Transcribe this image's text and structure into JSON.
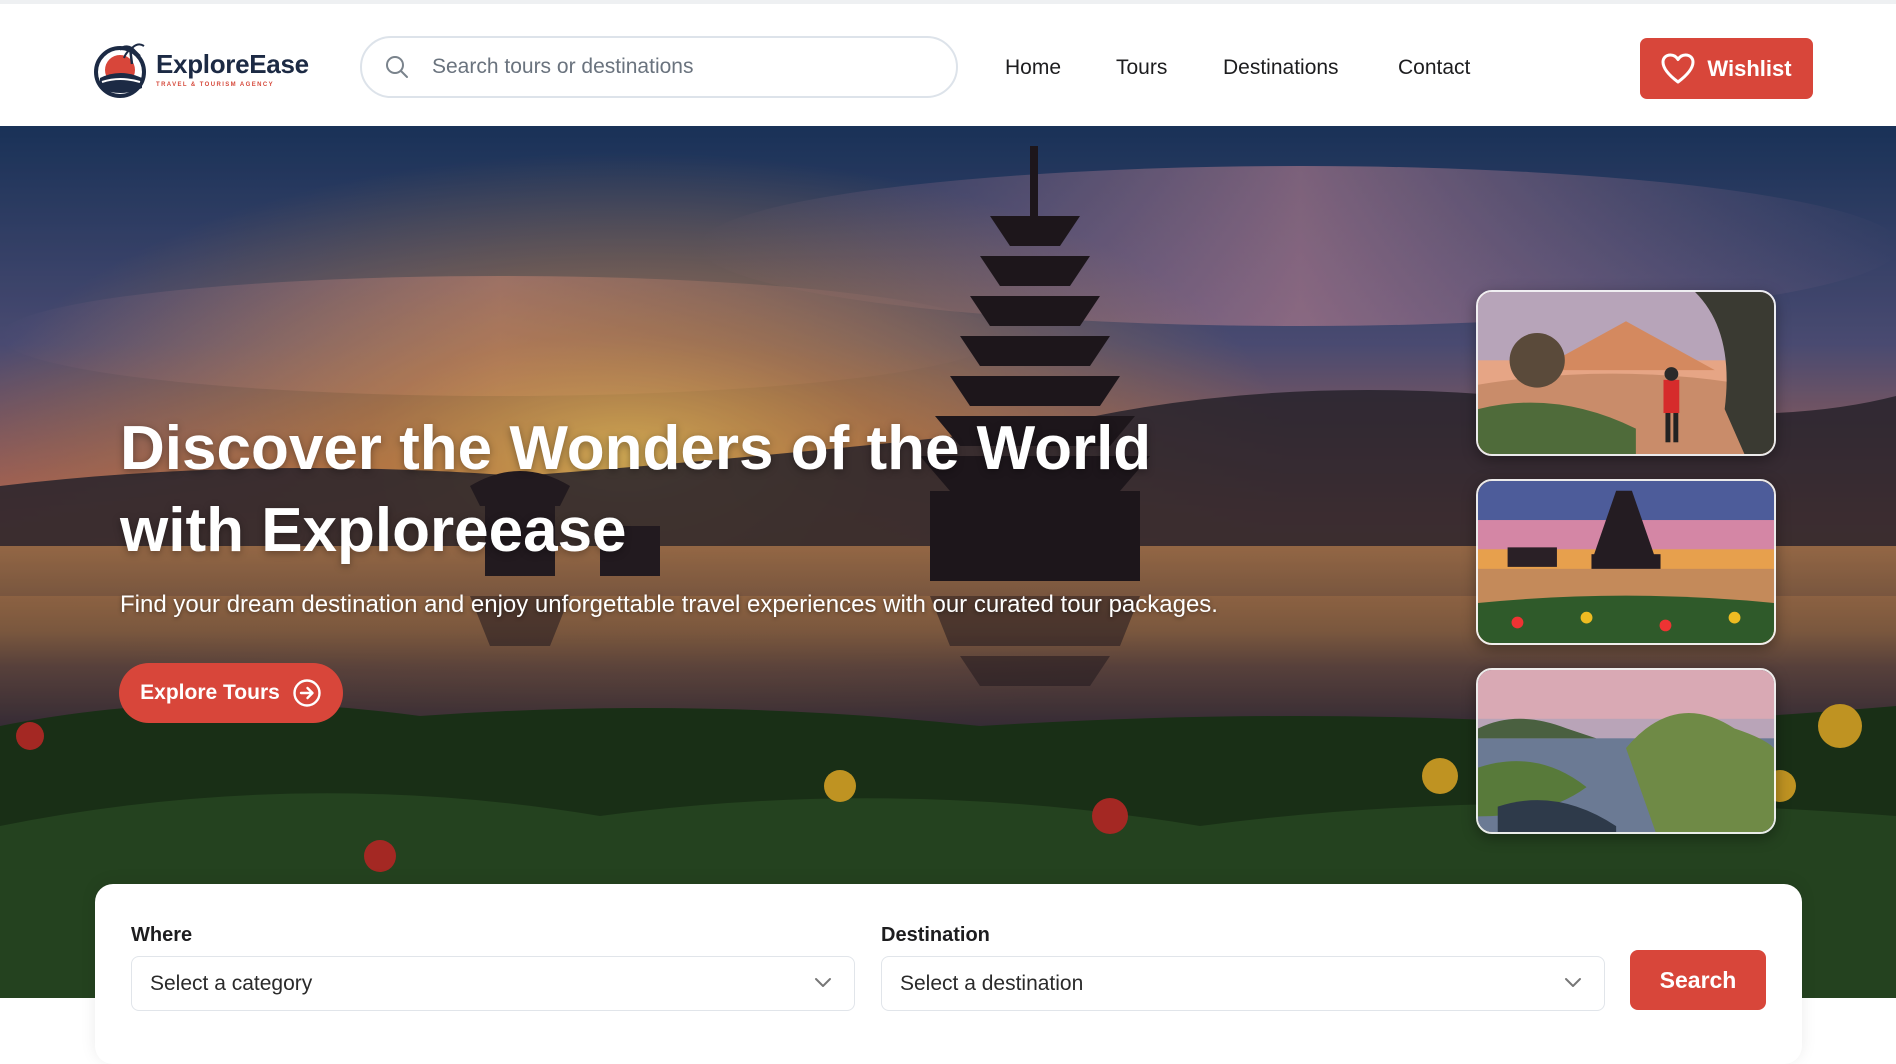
{
  "brand": {
    "name": "ExploreEase",
    "tagline": "TRAVEL & TOURISM AGENCY"
  },
  "search": {
    "placeholder": "Search tours or destinations",
    "icon": "search-icon"
  },
  "nav": {
    "items": [
      "Home",
      "Tours",
      "Destinations",
      "Contact"
    ]
  },
  "wishlist": {
    "label": "Wishlist",
    "icon": "heart-icon"
  },
  "hero": {
    "title_line1": "Discover the Wonders of the World",
    "title_line2": "with Exploreease",
    "subtitle": "Find your dream destination and enjoy unforgettable travel experiences with our curated tour packages.",
    "cta_label": "Explore Tours",
    "cta_icon": "arrow-right-circle-icon"
  },
  "search_panel": {
    "where_label": "Where",
    "where_value": "Select a category",
    "destination_label": "Destination",
    "destination_value": "Select a destination",
    "button_label": "Search"
  },
  "colors": {
    "accent": "#d8463a",
    "text_dark": "#1d1d1f",
    "brand_navy": "#1c2a44"
  }
}
